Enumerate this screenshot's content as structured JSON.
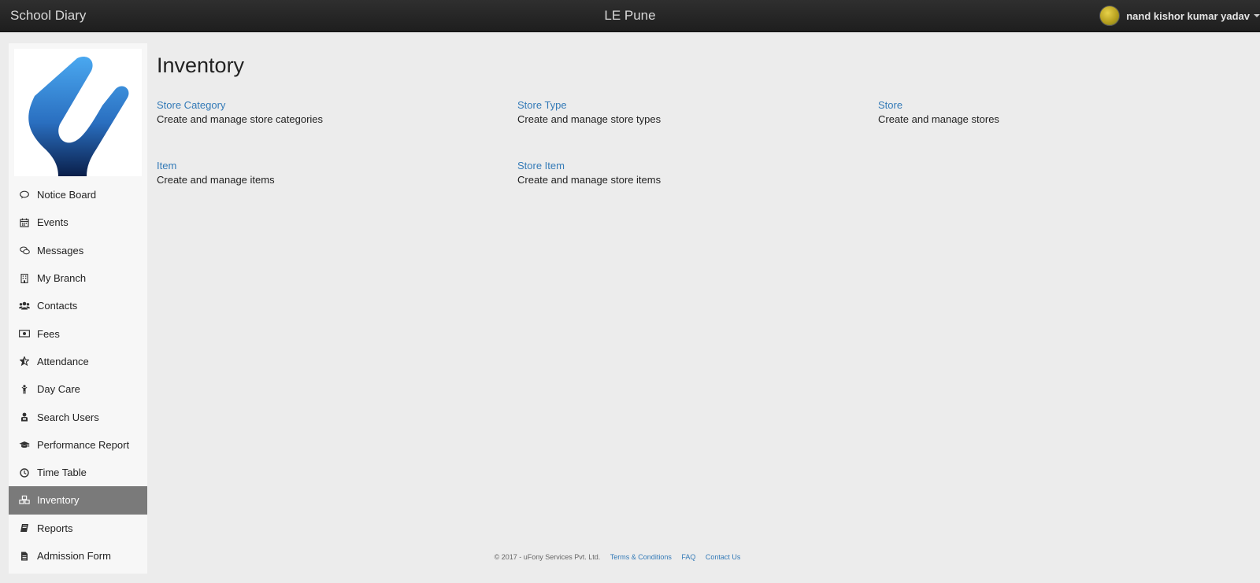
{
  "topbar": {
    "brand": "School Diary",
    "title": "LE Pune",
    "user_name": "nand kishor kumar yadav"
  },
  "sidebar": {
    "items": [
      {
        "label": "Notice Board",
        "icon": "comment-icon"
      },
      {
        "label": "Events",
        "icon": "calendar-icon"
      },
      {
        "label": "Messages",
        "icon": "chat-icon"
      },
      {
        "label": "My Branch",
        "icon": "building-icon"
      },
      {
        "label": "Contacts",
        "icon": "users-icon"
      },
      {
        "label": "Fees",
        "icon": "money-icon"
      },
      {
        "label": "Attendance",
        "icon": "star-icon"
      },
      {
        "label": "Day Care",
        "icon": "child-icon"
      },
      {
        "label": "Search Users",
        "icon": "user-search-icon"
      },
      {
        "label": "Performance Report",
        "icon": "graduation-cap-icon"
      },
      {
        "label": "Time Table",
        "icon": "clock-icon"
      },
      {
        "label": "Inventory",
        "icon": "cubes-icon",
        "active": true
      },
      {
        "label": "Reports",
        "icon": "book-icon"
      },
      {
        "label": "Admission Form",
        "icon": "file-icon"
      }
    ]
  },
  "main": {
    "title": "Inventory",
    "cards": [
      {
        "link": "Store Category",
        "desc": "Create and manage store categories"
      },
      {
        "link": "Store Type",
        "desc": "Create and manage store types"
      },
      {
        "link": "Store",
        "desc": "Create and manage stores"
      },
      {
        "link": "Item",
        "desc": "Create and manage items"
      },
      {
        "link": "Store Item",
        "desc": "Create and manage store items"
      }
    ]
  },
  "footer": {
    "copyright": "© 2017 - uFony Services Pvt. Ltd.",
    "terms": "Terms & Conditions",
    "faq": "FAQ",
    "contact": "Contact Us"
  },
  "colors": {
    "topbar": "#262626",
    "link": "#337ab7",
    "active_nav": "#7a7a7a",
    "background": "#ececec"
  }
}
